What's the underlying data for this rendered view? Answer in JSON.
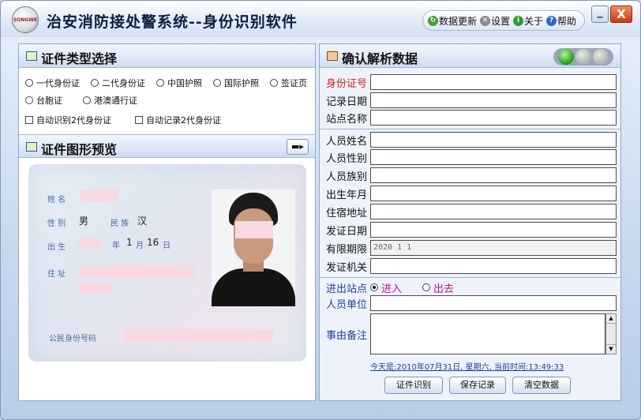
{
  "app": {
    "title": "治安消防接处警系统--身份识别软件",
    "logo_text": "SONGWE"
  },
  "toolbar": {
    "update": "数据更新",
    "settings": "设置",
    "about": "关于",
    "help": "帮助"
  },
  "window": {
    "minimize": "_",
    "close": "X"
  },
  "left": {
    "type_title": "证件类型选择",
    "types": [
      "一代身份证",
      "二代身份证",
      "中国护照",
      "国际护照",
      "签证页",
      "台胞证",
      "港澳通行证"
    ],
    "auto_options": [
      "自动识别2代身份证",
      "自动记录2代身份证"
    ],
    "preview_title": "证件图形预览",
    "card": {
      "name_label": "姓 名",
      "sex_label": "性 别",
      "sex_value": "男",
      "nation_label": "民 族",
      "nation_value": "汉",
      "birth_label": "出 生",
      "birth_year_label": "年",
      "birth_month": "1",
      "birth_month_label": "月",
      "birth_day": "16",
      "birth_day_label": "日",
      "address_label": "住 址",
      "id_label": "公民身份号码"
    }
  },
  "right": {
    "title": "确认解析数据",
    "fields": [
      {
        "label": "身份证号",
        "value": ""
      },
      {
        "label": "记录日期",
        "value": ""
      },
      {
        "label": "站点名称",
        "value": ""
      },
      {
        "label": "人员姓名",
        "value": ""
      },
      {
        "label": "人员性别",
        "value": ""
      },
      {
        "label": "人员族别",
        "value": ""
      },
      {
        "label": "出生年月",
        "value": ""
      },
      {
        "label": "住宿地址",
        "value": ""
      },
      {
        "label": "发证日期",
        "value": ""
      },
      {
        "label": "有限期限",
        "value": "2020 1 1"
      },
      {
        "label": "发证机关",
        "value": ""
      }
    ],
    "inout_label": "进出站点",
    "in_option": "进入",
    "out_option": "出去",
    "unit_label": "人员单位",
    "remark_label": "事由备注",
    "status": "今天是:2010年07月31日, 星期六, 当前时间:13:49:33",
    "buttons": {
      "recognize": "证件识别",
      "save": "保存记录",
      "clear": "清空数据"
    }
  }
}
